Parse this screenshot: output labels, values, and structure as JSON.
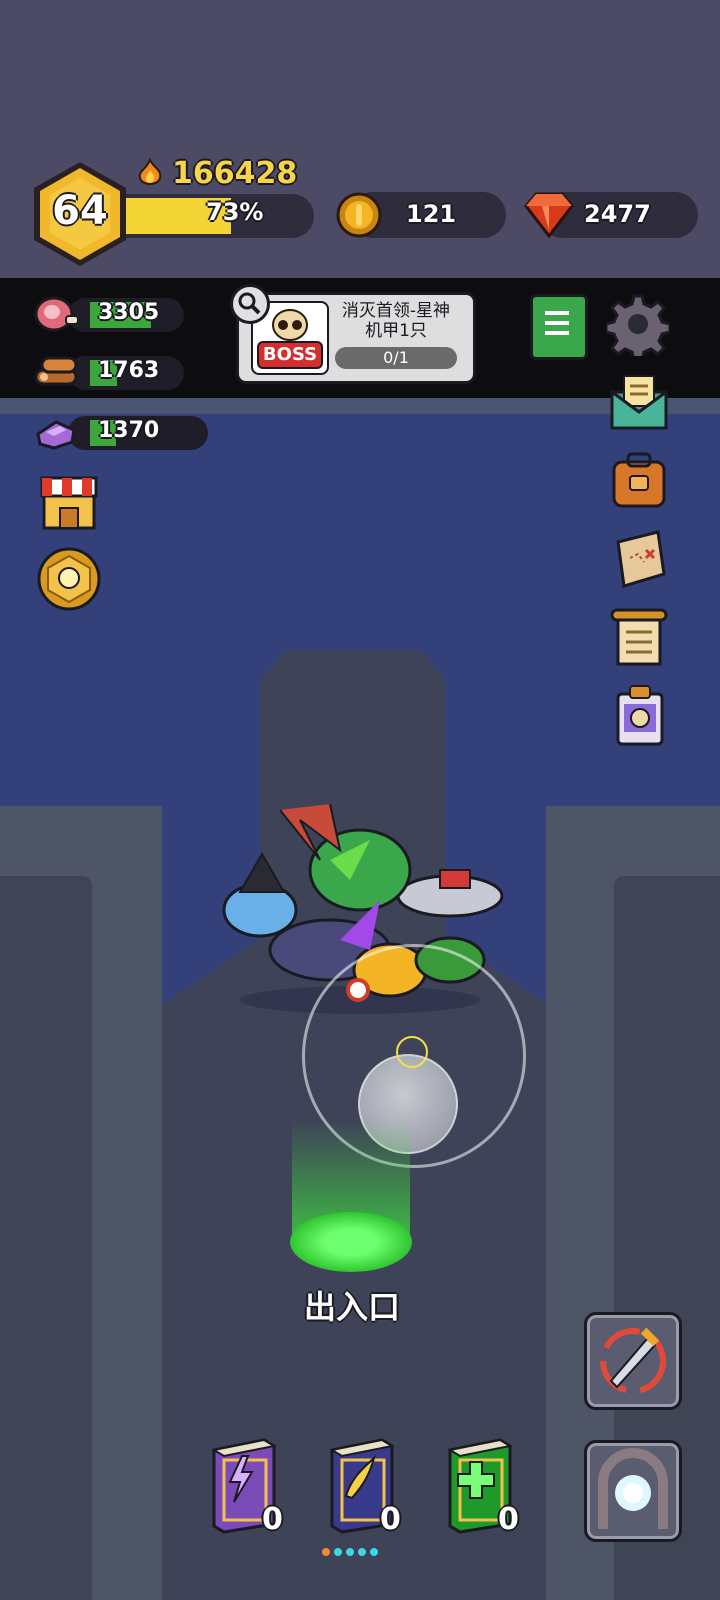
{
  "player": {
    "level": "64",
    "power": "166428",
    "xp_percent_label": "73%",
    "xp_progress": 0.73
  },
  "currencies": {
    "coins": "121",
    "gems": "2477"
  },
  "resources": [
    {
      "name": "meat-icon",
      "value": "3305",
      "fill": 0.55
    },
    {
      "name": "wood-icon",
      "value": "1763",
      "fill": 0.2
    },
    {
      "name": "ore-icon",
      "value": "1370",
      "fill": 0.15
    }
  ],
  "quest": {
    "badge": "BOSS",
    "title_line1": "消灭首领-星神",
    "title_line2": "机甲1只",
    "progress": "0/1"
  },
  "map": {
    "portal_label": "出入口"
  },
  "skill_books": [
    {
      "name": "lightning-book",
      "count": "0",
      "color": "#7b4bb8"
    },
    {
      "name": "wing-book",
      "count": "0",
      "color": "#3a3a8a"
    },
    {
      "name": "heal-book",
      "count": "0",
      "color": "#1f9a2a"
    }
  ],
  "colors": {
    "xp_bar": "#f2d435",
    "level_hex": "#f0b82a",
    "portal_glow": "#3ee53e",
    "power_text": "#f7d54a"
  }
}
